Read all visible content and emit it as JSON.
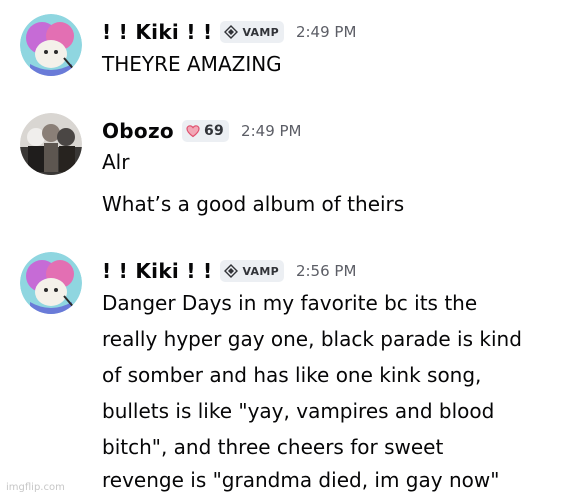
{
  "messages": [
    {
      "username": "! ! Kiki ! !",
      "tag": "VAMP",
      "tag_icon": "diamond-icon",
      "timestamp": "2:49 PM",
      "lines": [
        "THEYRE AMAZING"
      ]
    },
    {
      "username": "Obozo",
      "tag": "69",
      "tag_icon": "heart-icon",
      "timestamp": "2:49 PM",
      "lines": [
        "Alr",
        "What’s a good album of theirs"
      ]
    },
    {
      "username": "! ! Kiki ! !",
      "tag": "VAMP",
      "tag_icon": "diamond-icon",
      "timestamp": "2:56 PM",
      "lines": [
        "Danger Days in my favorite bc its the",
        "really hyper gay one, black parade is kind",
        "of somber and has like one kink song,",
        "bullets is like \"yay, vampires and blood",
        "bitch\", and three cheers for sweet",
        "revenge is \"grandma died, im gay now\""
      ]
    }
  ],
  "watermark": "imgflip.com",
  "colors": {
    "background": "#ffffff",
    "text": "#060607",
    "timestamp": "#5c5e66",
    "tag_bg": "#eceff3",
    "heart": "#e0516f"
  }
}
